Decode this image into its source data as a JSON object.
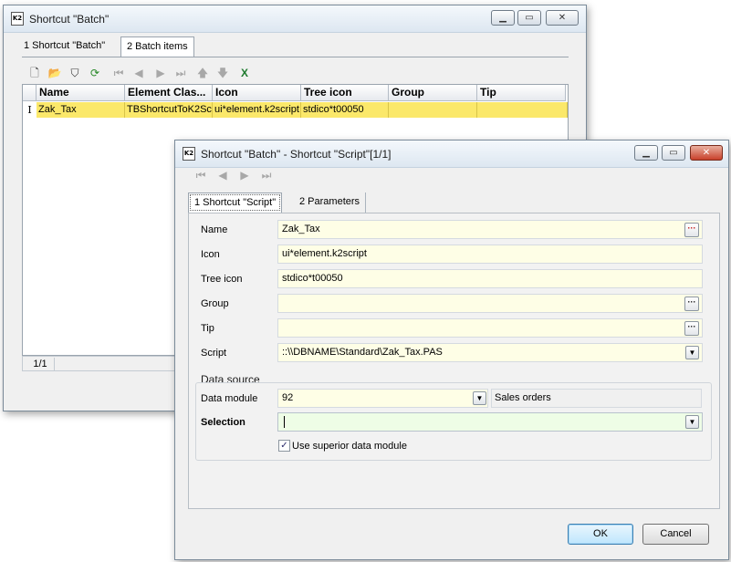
{
  "back_window": {
    "title": "Shortcut \"Batch\"",
    "tabs": [
      {
        "label": "1 Shortcut \"Batch\""
      },
      {
        "label": "2 Batch items"
      }
    ],
    "grid": {
      "columns": [
        "Name",
        "Element Clas...",
        "Icon",
        "Tree icon",
        "Group",
        "Tip"
      ],
      "row": {
        "indicator": "I",
        "cells": [
          "Zak_Tax",
          "TBShortcutToK2Sc",
          "ui*element.k2script",
          "stdico*t00050",
          "",
          ""
        ]
      }
    },
    "status": "1/1"
  },
  "front_window": {
    "title": "Shortcut \"Batch\" - Shortcut \"Script\"[1/1]",
    "tabs": [
      {
        "label": "1 Shortcut \"Script\""
      },
      {
        "label": "2 Parameters"
      }
    ],
    "fields": {
      "name": {
        "label": "Name",
        "value": "Zak_Tax"
      },
      "icon": {
        "label": "Icon",
        "value": "ui*element.k2script"
      },
      "tree_icon": {
        "label": "Tree icon",
        "value": "stdico*t00050"
      },
      "group": {
        "label": "Group",
        "value": ""
      },
      "tip": {
        "label": "Tip",
        "value": ""
      },
      "script": {
        "label": "Script",
        "value": "::\\\\DBNAME\\Standard\\Zak_Tax.PAS"
      }
    },
    "data_source": {
      "title": "Data source",
      "data_module_label": "Data module",
      "data_module_value": "92",
      "data_module_name": "Sales orders",
      "selection_label": "Selection",
      "selection_value": "",
      "use_superior_label": "Use superior data module",
      "use_superior_checked": true
    },
    "buttons": {
      "ok": "OK",
      "cancel": "Cancel"
    }
  },
  "colors": {
    "highlight_row": "#fbe86a",
    "field_bg": "#fefee6"
  }
}
